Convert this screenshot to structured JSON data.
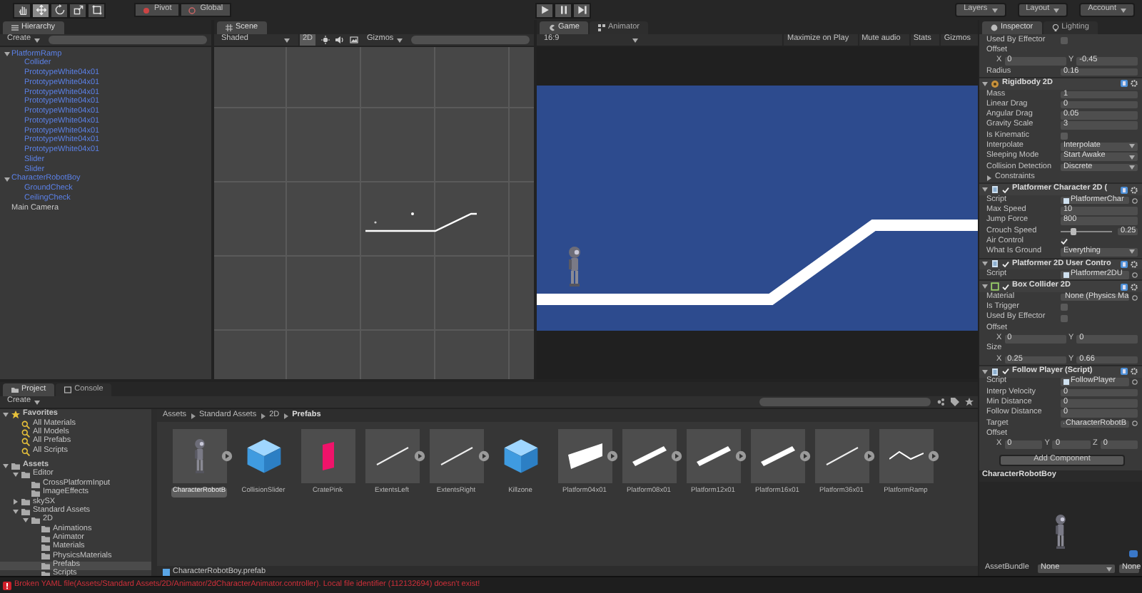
{
  "toolbar": {
    "tools": [
      {
        "kind": "hand",
        "selected": false
      },
      {
        "kind": "move",
        "selected": true
      },
      {
        "kind": "rotate",
        "selected": false
      },
      {
        "kind": "scale",
        "selected": false
      },
      {
        "kind": "rect",
        "selected": false
      }
    ],
    "pivot": "Pivot",
    "space": "Global",
    "play_controls": [
      {
        "kind": "play",
        "on": false
      },
      {
        "kind": "pause",
        "on": false
      },
      {
        "kind": "step",
        "on": false
      }
    ],
    "layers": "Layers",
    "layout": "Layout",
    "account": "Account"
  },
  "hierarchy": {
    "tab": "Hierarchy",
    "create": "Create",
    "items": [
      {
        "label": "PlatformRamp",
        "kind": "prefab",
        "expanded": true,
        "children": [
          {
            "label": "Collider",
            "kind": "prefab"
          },
          {
            "label": "PrototypeWhite04x01",
            "kind": "prefab"
          },
          {
            "label": "PrototypeWhite04x01",
            "kind": "prefab"
          },
          {
            "label": "PrototypeWhite04x01",
            "kind": "prefab"
          },
          {
            "label": "PrototypeWhite04x01",
            "kind": "prefab"
          },
          {
            "label": "PrototypeWhite04x01",
            "kind": "prefab"
          },
          {
            "label": "PrototypeWhite04x01",
            "kind": "prefab"
          },
          {
            "label": "PrototypeWhite04x01",
            "kind": "prefab"
          },
          {
            "label": "PrototypeWhite04x01",
            "kind": "prefab"
          },
          {
            "label": "PrototypeWhite04x01",
            "kind": "prefab"
          },
          {
            "label": "Slider",
            "kind": "prefab"
          },
          {
            "label": "Slider",
            "kind": "prefab"
          }
        ]
      },
      {
        "label": "CharacterRobotBoy",
        "kind": "prefab",
        "expanded": true,
        "children": [
          {
            "label": "GroundCheck",
            "kind": "prefab"
          },
          {
            "label": "CeilingCheck",
            "kind": "prefab"
          }
        ]
      },
      {
        "label": "Main Camera",
        "kind": "object"
      }
    ]
  },
  "scene": {
    "tab": "Scene",
    "shading": "Shaded",
    "mode_2d": {
      "label": "2D",
      "on": true
    },
    "gizmos": "Gizmos"
  },
  "game": {
    "tabs": [
      {
        "label": "Game",
        "selected": true
      },
      {
        "label": "Animator",
        "selected": false
      }
    ],
    "aspect": "16:9",
    "toggles": [
      {
        "label": "Maximize on Play",
        "on": false
      },
      {
        "label": "Mute audio",
        "on": false
      },
      {
        "label": "Stats",
        "on": false
      },
      {
        "label": "Gizmos",
        "on": false
      }
    ]
  },
  "inspector": {
    "tabs": [
      {
        "label": "Inspector",
        "selected": true
      },
      {
        "label": "Lighting",
        "selected": false
      }
    ],
    "rows": [
      {
        "kind": "checkbox",
        "label": "Used By Effector",
        "checked": false
      },
      {
        "kind": "label",
        "label": "Offset"
      },
      {
        "kind": "vector",
        "axes": [
          {
            "axis": "X",
            "value": "0"
          },
          {
            "axis": "Y",
            "value": "-0.45"
          }
        ]
      },
      {
        "kind": "field",
        "label": "Radius",
        "value": "0.16"
      },
      {
        "kind": "rigidbody_component",
        "title": "Rigidbody 2D"
      },
      {
        "kind": "field",
        "label": "Mass",
        "value": "1"
      },
      {
        "kind": "field",
        "label": "Linear Drag",
        "value": "0"
      },
      {
        "kind": "field",
        "label": "Angular Drag",
        "value": "0.05"
      },
      {
        "kind": "field",
        "label": "Gravity Scale",
        "value": "3"
      },
      {
        "kind": "checkbox",
        "label": "Is Kinematic",
        "checked": false
      },
      {
        "kind": "dropdown",
        "label": "Interpolate",
        "value": "Interpolate"
      },
      {
        "kind": "dropdown",
        "label": "Sleeping Mode",
        "value": "Start Awake"
      },
      {
        "kind": "dropdown",
        "label": "Collision Detection",
        "value": "Discrete"
      },
      {
        "kind": "foldout",
        "label": "Constraints",
        "expanded": false
      },
      {
        "kind": "script_component",
        "title": "Platformer Character 2D (",
        "enabled": true
      },
      {
        "kind": "object",
        "label": "Script",
        "value": "PlatformerChar"
      },
      {
        "kind": "field",
        "label": "Max Speed",
        "value": "10"
      },
      {
        "kind": "field",
        "label": "Jump Force",
        "value": "800"
      },
      {
        "kind": "slider",
        "label": "Crouch Speed",
        "level": 0.25,
        "value": "0.25"
      },
      {
        "kind": "checkbox",
        "label": "Air Control",
        "checked": true
      },
      {
        "kind": "dropdown",
        "label": "What Is Ground",
        "value": "Everything"
      },
      {
        "kind": "script_component",
        "title": "Platformer 2D User Contro",
        "enabled": true
      },
      {
        "kind": "object",
        "label": "Script",
        "value": "Platformer2DU"
      },
      {
        "kind": "collider_component",
        "title": "Box Collider 2D",
        "enabled": true
      },
      {
        "kind": "object",
        "label": "Material",
        "value": "None (Physics Ma"
      },
      {
        "kind": "checkbox",
        "label": "Is Trigger",
        "checked": false
      },
      {
        "kind": "checkbox",
        "label": "Used By Effector",
        "checked": false
      },
      {
        "kind": "label",
        "label": "Offset"
      },
      {
        "kind": "vector",
        "axes": [
          {
            "axis": "X",
            "value": "0"
          },
          {
            "axis": "Y",
            "value": "0"
          }
        ]
      },
      {
        "kind": "label",
        "label": "Size"
      },
      {
        "kind": "vector",
        "axes": [
          {
            "axis": "X",
            "value": "0.25"
          },
          {
            "axis": "Y",
            "value": "0.66"
          }
        ]
      },
      {
        "kind": "script_component",
        "title": "Follow Player (Script)",
        "enabled": true
      },
      {
        "kind": "object",
        "label": "Script",
        "value": "FollowPlayer"
      },
      {
        "kind": "field",
        "label": "Interp Velocity",
        "value": "0"
      },
      {
        "kind": "field",
        "label": "Min Distance",
        "value": "0"
      },
      {
        "kind": "field",
        "label": "Follow Distance",
        "value": "0"
      },
      {
        "kind": "object",
        "label": "Target",
        "value": "CharacterRobotB"
      },
      {
        "kind": "label",
        "label": "Offset"
      },
      {
        "kind": "vector",
        "axes": [
          {
            "axis": "X",
            "value": "0"
          },
          {
            "axis": "Y",
            "value": "0"
          },
          {
            "axis": "Z",
            "value": "0"
          }
        ]
      },
      {
        "kind": "button",
        "label": "Add Component"
      }
    ],
    "preview": {
      "title": "CharacterRobotBoy",
      "asset_bundle": {
        "label": "AssetBundle",
        "name": "None",
        "variant": "None"
      }
    }
  },
  "project": {
    "tabs": [
      {
        "label": "Project",
        "selected": true
      },
      {
        "label": "Console",
        "selected": false
      }
    ],
    "create": "Create",
    "tree": [
      {
        "label": "Favorites",
        "kind": "favorites",
        "selected": false,
        "expanded": true,
        "children": [
          {
            "label": "All Materials",
            "kind": "search",
            "selected": false
          },
          {
            "label": "All Models",
            "kind": "search",
            "selected": false
          },
          {
            "label": "All Prefabs",
            "kind": "search",
            "selected": false
          },
          {
            "label": "All Scripts",
            "kind": "search",
            "selected": false
          }
        ]
      },
      {
        "label": "Assets",
        "kind": "folder",
        "selected": false,
        "expanded": true,
        "children": [
          {
            "label": "Editor",
            "kind": "folder",
            "selected": false,
            "expanded": true,
            "children": [
              {
                "label": "CrossPlatformInput",
                "kind": "folder",
                "selected": false
              },
              {
                "label": "ImageEffects",
                "kind": "folder",
                "selected": false
              }
            ]
          },
          {
            "label": "skySX",
            "kind": "folder",
            "selected": false,
            "expanded": false
          },
          {
            "label": "Standard Assets",
            "kind": "folder",
            "selected": false,
            "expanded": true,
            "children": [
              {
                "label": "2D",
                "kind": "folder",
                "selected": false,
                "expanded": true,
                "children": [
                  {
                    "label": "Animations",
                    "kind": "folder",
                    "selected": false
                  },
                  {
                    "label": "Animator",
                    "kind": "folder",
                    "selected": false
                  },
                  {
                    "label": "Materials",
                    "kind": "folder",
                    "selected": false
                  },
                  {
                    "label": "PhysicsMaterials",
                    "kind": "folder",
                    "selected": false
                  },
                  {
                    "label": "Prefabs",
                    "kind": "folder",
                    "selected": true
                  },
                  {
                    "label": "Scripts",
                    "kind": "folder",
                    "selected": false
                  }
                ]
              }
            ]
          }
        ]
      }
    ],
    "breadcrumb": [
      "Assets",
      "Standard Assets",
      "2D",
      "Prefabs"
    ],
    "items": [
      {
        "label": "CharacterRobotB",
        "kind": "character",
        "expandable": true,
        "selected": true
      },
      {
        "label": "CollisionSlider",
        "kind": "cube",
        "expandable": false,
        "selected": false
      },
      {
        "label": "CratePink",
        "kind": "crate",
        "expandable": false,
        "selected": false
      },
      {
        "label": "ExtentsLeft",
        "kind": "line",
        "expandable": true,
        "selected": false
      },
      {
        "label": "ExtentsRight",
        "kind": "line",
        "expandable": true,
        "selected": false
      },
      {
        "label": "Killzone",
        "kind": "cube",
        "expandable": false,
        "selected": false
      },
      {
        "label": "Platform04x01",
        "kind": "slab",
        "expandable": true,
        "selected": false
      },
      {
        "label": "Platform08x01",
        "kind": "bar",
        "expandable": true,
        "selected": false
      },
      {
        "label": "Platform12x01",
        "kind": "bar",
        "expandable": true,
        "selected": false
      },
      {
        "label": "Platform16x01",
        "kind": "bar",
        "expandable": true,
        "selected": false
      },
      {
        "label": "Platform36x01",
        "kind": "line",
        "expandable": true,
        "selected": false
      },
      {
        "label": "PlatformRamp",
        "kind": "ramp",
        "expandable": true,
        "selected": false
      }
    ],
    "selected_path": "CharacterRobotBoy.prefab"
  },
  "status_bar": {
    "message": "Broken YAML file(Assets/Standard Assets/2D/Animator/2dCharacterAnimator.controller). Local file identifier (112132694) doesn't exist!"
  }
}
